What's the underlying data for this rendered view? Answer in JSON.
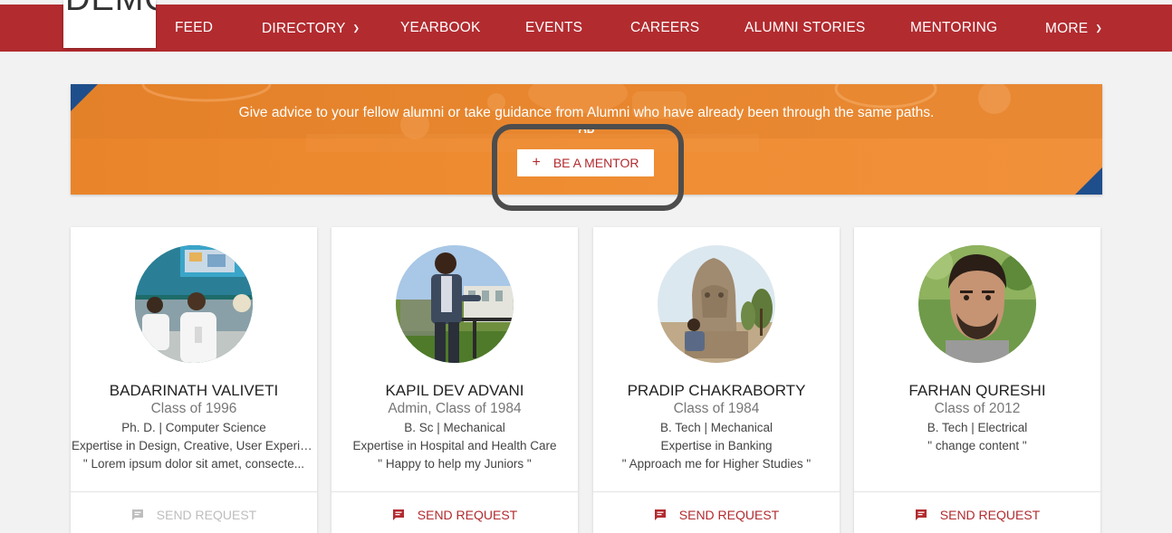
{
  "nav": {
    "logo_text": "DEMO",
    "items": [
      {
        "label": "FEED",
        "has_dropdown": false
      },
      {
        "label": "DIRECTORY",
        "has_dropdown": true
      },
      {
        "label": "YEARBOOK",
        "has_dropdown": false
      },
      {
        "label": "EVENTS",
        "has_dropdown": false
      },
      {
        "label": "CAREERS",
        "has_dropdown": false
      },
      {
        "label": "ALUMNI STORIES",
        "has_dropdown": false
      },
      {
        "label": "MENTORING",
        "has_dropdown": false
      },
      {
        "label": "MORE",
        "has_dropdown": true
      }
    ],
    "chevron_glyph": "⌄"
  },
  "banner": {
    "text": "Give advice to your fellow alumni or take guidance from Alumni who have already been through the same paths.",
    "or_text": "OR",
    "button_icon": "+",
    "button_label": "BE A MENTOR"
  },
  "cards": [
    {
      "name": "BADARINATH VALIVETI",
      "class": "Class of 1996",
      "degree": "Ph. D. | Computer Science",
      "expertise": "Expertise in Design, Creative, User Experie...",
      "quote": "\" Lorem ipsum dolor sit amet, consecte...",
      "request": "SEND REQUEST",
      "request_enabled": false
    },
    {
      "name": "KAPIL DEV ADVANI",
      "class": "Admin, Class of 1984",
      "degree": "B. Sc | Mechanical",
      "expertise": "Expertise in Hospital and Health Care",
      "quote": "\" Happy to help my Juniors \"",
      "request": "SEND REQUEST",
      "request_enabled": true
    },
    {
      "name": "PRADIP CHAKRABORTY",
      "class": "Class of 1984",
      "degree": "B. Tech | Mechanical",
      "expertise": "Expertise in Banking",
      "quote": "\" Approach me for Higher Studies \"",
      "request": "SEND REQUEST",
      "request_enabled": true
    },
    {
      "name": "FARHAN QURESHI",
      "class": "Class of 2012",
      "degree": "B. Tech | Electrical",
      "expertise": "\" change content \"",
      "quote": "",
      "request": "SEND REQUEST",
      "request_enabled": true
    }
  ],
  "colors": {
    "brand_red": "#b22b2f",
    "banner_orange": "#ee8a30",
    "corner_blue": "#1f4e8c",
    "highlight": "#4d4d4d"
  },
  "icons": {
    "request_icon": "message-icon",
    "dropdown_icon": "chevron-down-icon"
  }
}
